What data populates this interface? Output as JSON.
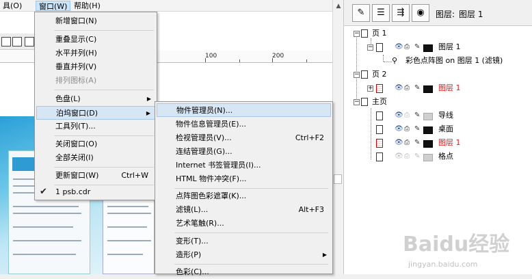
{
  "menubar": {
    "items": [
      "具(O)",
      "窗口(W)",
      "帮助(H)"
    ]
  },
  "ruler": {
    "labels": [
      "100",
      "200"
    ]
  },
  "window_menu": {
    "items": [
      {
        "label": "新增窗口(N)"
      },
      {
        "label": "重叠显示(C)"
      },
      {
        "label": "水平并列(H)"
      },
      {
        "label": "垂直并列(V)"
      },
      {
        "label": "排列图标(A)",
        "disabled": true
      },
      {
        "label": "色盘(L)",
        "submenu": true
      },
      {
        "label": "泊坞窗口(D)",
        "submenu": true,
        "selected": true
      },
      {
        "label": "工具列(T)..."
      },
      {
        "label": "关闭窗口(O)"
      },
      {
        "label": "全部关闭(I)"
      },
      {
        "label": "更新窗口(W)",
        "shortcut": "Ctrl+W"
      },
      {
        "label": "1 psb.cdr",
        "checked": true
      }
    ]
  },
  "docker_menu": {
    "items": [
      {
        "label": "物件管理员(N)...",
        "selected": true
      },
      {
        "label": "物件信息管理员(E)..."
      },
      {
        "label": "检视管理员(V)...",
        "shortcut": "Ctrl+F2"
      },
      {
        "label": "连结管理员(G)..."
      },
      {
        "label": "Internet 书签管理员(I)..."
      },
      {
        "label": "HTML 物件冲突(F)..."
      },
      {
        "label": "点阵图色彩遮罩(K)..."
      },
      {
        "label": "滤镜(L)...",
        "shortcut": "Alt+F3"
      },
      {
        "label": "艺术笔触(R)..."
      },
      {
        "label": "变形(T)...",
        "submenu": true
      },
      {
        "label": "造形(P)",
        "submenu": true
      },
      {
        "label": "色彩(C)..."
      }
    ]
  },
  "panel": {
    "header_title": "图层:",
    "header_value": "图层 1",
    "tree": {
      "page1": "页 1",
      "page1_layer": "图层 1",
      "page1_filter": "彩色点阵图 on 图层 1 (滤镜)",
      "page2": "页 2",
      "page2_layer": "图层 1",
      "master": "主页",
      "master_guides": "导线",
      "master_desktop": "桌面",
      "master_layer": "图层 1",
      "master_grid": "格点"
    }
  },
  "watermark": {
    "brand": "Baidu经验",
    "url": "jingyan.baidu.com"
  },
  "colors": {
    "accent": "#2e9bd3",
    "selection": "#d6e6f5",
    "red_layer": "#e02020"
  }
}
